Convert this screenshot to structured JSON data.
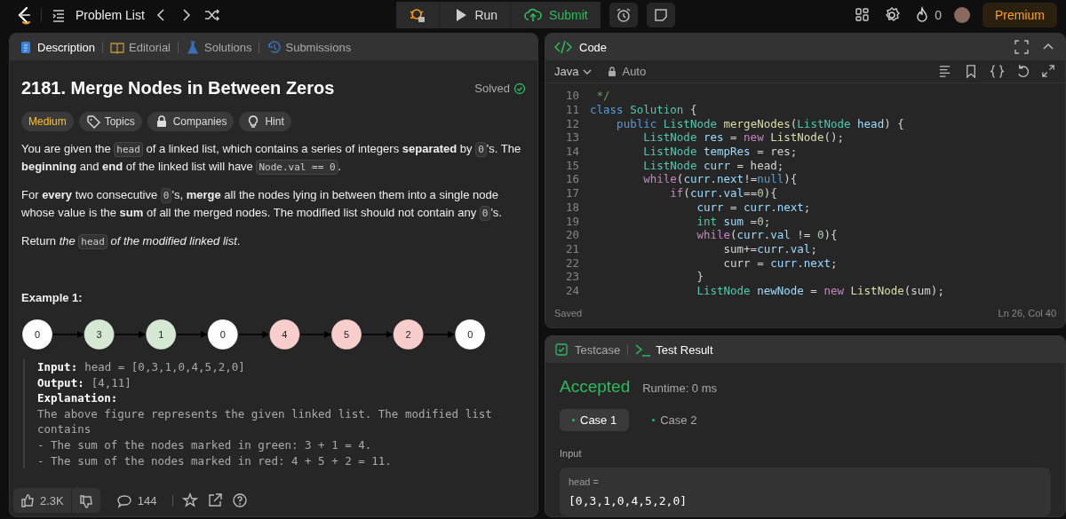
{
  "topbar": {
    "nav_label": "Problem List",
    "actions": [
      {
        "label": "Run",
        "kind": "run"
      },
      {
        "label": "Submit",
        "kind": "submit"
      }
    ],
    "streak": "0",
    "premium": "Premium"
  },
  "description_panel": {
    "tabs": [
      {
        "label": "Description",
        "kind": "description",
        "selected": true
      },
      {
        "label": "Editorial",
        "kind": "editorial",
        "selected": false
      },
      {
        "label": "Solutions",
        "kind": "solutions",
        "selected": false
      },
      {
        "label": "Submissions",
        "kind": "submissions",
        "selected": false
      }
    ],
    "title": "2181. Merge Nodes in Between Zeros",
    "status": "Solved",
    "tags": [
      {
        "label": "Medium",
        "kind": "difficulty"
      },
      {
        "label": "Topics",
        "kind": "topics"
      },
      {
        "label": "Companies",
        "kind": "companies"
      },
      {
        "label": "Hint",
        "kind": "hint"
      }
    ],
    "paragraphs": [
      [
        {
          "kind": "text",
          "text": "You are given the "
        },
        {
          "kind": "code",
          "text": "head"
        },
        {
          "kind": "text",
          "text": " of a linked list, which contains a series of integers **separated** by "
        },
        {
          "kind": "code",
          "text": "0"
        },
        {
          "kind": "text",
          "text": "'s. The **beginning** and **end** of the linked list will have "
        },
        {
          "kind": "code",
          "text": "Node.val == 0"
        },
        {
          "kind": "text",
          "text": "."
        }
      ],
      [
        {
          "kind": "text",
          "text": "For **every** two consecutive "
        },
        {
          "kind": "code",
          "text": "0"
        },
        {
          "kind": "text",
          "text": "'s, **merge** all the nodes lying in between them into a single node whose value is the **sum** of all the merged nodes. The modified list should not contain any "
        },
        {
          "kind": "code",
          "text": "0"
        },
        {
          "kind": "text",
          "text": "'s."
        }
      ],
      [
        {
          "kind": "text",
          "text": "Return *the* "
        },
        {
          "kind": "code",
          "text": "head"
        },
        {
          "kind": "text",
          "text": " *of the modified linked list*."
        }
      ]
    ],
    "example": {
      "title": "Example 1:",
      "nodes": [
        {
          "value": "0",
          "color": "#ffffff"
        },
        {
          "value": "3",
          "color": "#d5e8d4"
        },
        {
          "value": "1",
          "color": "#d5e8d4"
        },
        {
          "value": "0",
          "color": "#ffffff"
        },
        {
          "value": "4",
          "color": "#f8cecc"
        },
        {
          "value": "5",
          "color": "#f8cecc"
        },
        {
          "value": "2",
          "color": "#f8cecc"
        },
        {
          "value": "0",
          "color": "#ffffff"
        }
      ],
      "lines": [
        {
          "label": "Input:",
          "text": "head = [0,3,1,0,4,5,2,0]"
        },
        {
          "label": "Output:",
          "text": "[4,11]"
        },
        {
          "label": "Explanation:"
        }
      ],
      "explanation": [
        "The above figure represents the given linked list. The modified list contains",
        "- The sum of the nodes marked in green: 3 + 1 = 4.",
        "- The sum of the nodes marked in red: 4 + 5 + 2 = 11."
      ]
    },
    "footer": {
      "likes": "2.3K",
      "comments": "144"
    }
  },
  "code_panel": {
    "title": "Code",
    "language": "Java",
    "mode": "Auto",
    "lines": [
      {
        "number": "10",
        "tokens": [
          {
            "kind": "comment",
            "text": " */"
          }
        ]
      },
      {
        "number": "11",
        "tokens": [
          {
            "kind": "keyword",
            "text": "class "
          },
          {
            "kind": "type",
            "text": "Solution"
          },
          {
            "kind": "plain",
            "text": " {"
          }
        ]
      },
      {
        "number": "12",
        "tokens": [
          {
            "kind": "keyword",
            "text": "    public "
          },
          {
            "kind": "type",
            "text": "ListNode "
          },
          {
            "kind": "function",
            "text": "mergeNodes"
          },
          {
            "kind": "plain",
            "text": "("
          },
          {
            "kind": "type",
            "text": "ListNode "
          },
          {
            "kind": "variable",
            "text": "head"
          },
          {
            "kind": "plain",
            "text": ") {"
          }
        ]
      },
      {
        "number": "13",
        "tokens": [
          {
            "kind": "type",
            "text": "        ListNode "
          },
          {
            "kind": "variable",
            "text": "res"
          },
          {
            "kind": "plain",
            "text": " = "
          },
          {
            "kind": "control",
            "text": "new "
          },
          {
            "kind": "function",
            "text": "ListNode"
          },
          {
            "kind": "plain",
            "text": "();"
          }
        ]
      },
      {
        "number": "14",
        "tokens": [
          {
            "kind": "type",
            "text": "        ListNode "
          },
          {
            "kind": "variable",
            "text": "tempRes"
          },
          {
            "kind": "plain",
            "text": " = res;"
          }
        ]
      },
      {
        "number": "15",
        "tokens": [
          {
            "kind": "type",
            "text": "        ListNode "
          },
          {
            "kind": "variable",
            "text": "curr"
          },
          {
            "kind": "plain",
            "text": " = head;"
          }
        ]
      },
      {
        "number": "16",
        "tokens": [
          {
            "kind": "control",
            "text": "        while"
          },
          {
            "kind": "plain",
            "text": "("
          },
          {
            "kind": "variable",
            "text": "curr"
          },
          {
            "kind": "plain",
            "text": "."
          },
          {
            "kind": "variable",
            "text": "next"
          },
          {
            "kind": "plain",
            "text": "!="
          },
          {
            "kind": "keyword",
            "text": "null"
          },
          {
            "kind": "plain",
            "text": "){"
          }
        ]
      },
      {
        "number": "17",
        "tokens": [
          {
            "kind": "control",
            "text": "            if"
          },
          {
            "kind": "plain",
            "text": "("
          },
          {
            "kind": "variable",
            "text": "curr"
          },
          {
            "kind": "plain",
            "text": "."
          },
          {
            "kind": "variable",
            "text": "val"
          },
          {
            "kind": "plain",
            "text": "=="
          },
          {
            "kind": "number",
            "text": "0"
          },
          {
            "kind": "plain",
            "text": "){"
          }
        ]
      },
      {
        "number": "18",
        "tokens": [
          {
            "kind": "variable",
            "text": "                curr"
          },
          {
            "kind": "plain",
            "text": " = "
          },
          {
            "kind": "variable",
            "text": "curr"
          },
          {
            "kind": "plain",
            "text": "."
          },
          {
            "kind": "variable",
            "text": "next"
          },
          {
            "kind": "plain",
            "text": ";"
          }
        ]
      },
      {
        "number": "19",
        "tokens": [
          {
            "kind": "type",
            "text": "                int "
          },
          {
            "kind": "variable",
            "text": "sum"
          },
          {
            "kind": "plain",
            "text": " ="
          },
          {
            "kind": "number",
            "text": "0"
          },
          {
            "kind": "plain",
            "text": ";"
          }
        ]
      },
      {
        "number": "20",
        "tokens": [
          {
            "kind": "control",
            "text": "                while"
          },
          {
            "kind": "plain",
            "text": "("
          },
          {
            "kind": "variable",
            "text": "curr"
          },
          {
            "kind": "plain",
            "text": "."
          },
          {
            "kind": "variable",
            "text": "val"
          },
          {
            "kind": "plain",
            "text": " != "
          },
          {
            "kind": "number",
            "text": "0"
          },
          {
            "kind": "plain",
            "text": "){"
          }
        ]
      },
      {
        "number": "21",
        "tokens": [
          {
            "kind": "plain",
            "text": "                    sum+="
          },
          {
            "kind": "variable",
            "text": "curr"
          },
          {
            "kind": "plain",
            "text": "."
          },
          {
            "kind": "variable",
            "text": "val"
          },
          {
            "kind": "plain",
            "text": ";"
          }
        ]
      },
      {
        "number": "22",
        "tokens": [
          {
            "kind": "plain",
            "text": "                    curr = "
          },
          {
            "kind": "variable",
            "text": "curr"
          },
          {
            "kind": "plain",
            "text": "."
          },
          {
            "kind": "variable",
            "text": "next"
          },
          {
            "kind": "plain",
            "text": ";"
          }
        ]
      },
      {
        "number": "23",
        "tokens": [
          {
            "kind": "plain",
            "text": "                }"
          }
        ]
      },
      {
        "number": "24",
        "tokens": [
          {
            "kind": "type",
            "text": "                ListNode "
          },
          {
            "kind": "variable",
            "text": "newNode"
          },
          {
            "kind": "plain",
            "text": " = "
          },
          {
            "kind": "control",
            "text": "new "
          },
          {
            "kind": "function",
            "text": "ListNode"
          },
          {
            "kind": "plain",
            "text": "(sum);"
          }
        ]
      }
    ],
    "status": "Saved",
    "cursor": "Ln 26, Col 40"
  },
  "test_panel": {
    "tabs": [
      {
        "label": "Testcase",
        "kind": "testcase",
        "selected": false
      },
      {
        "label": "Test Result",
        "kind": "result",
        "selected": true
      }
    ],
    "verdict": "Accepted",
    "runtime": "Runtime: 0 ms",
    "cases": [
      {
        "label": "Case 1",
        "selected": true
      },
      {
        "label": "Case 2",
        "selected": false
      }
    ],
    "input_label": "Input",
    "param": "head =",
    "value": "[0,3,1,0,4,5,2,0]"
  }
}
